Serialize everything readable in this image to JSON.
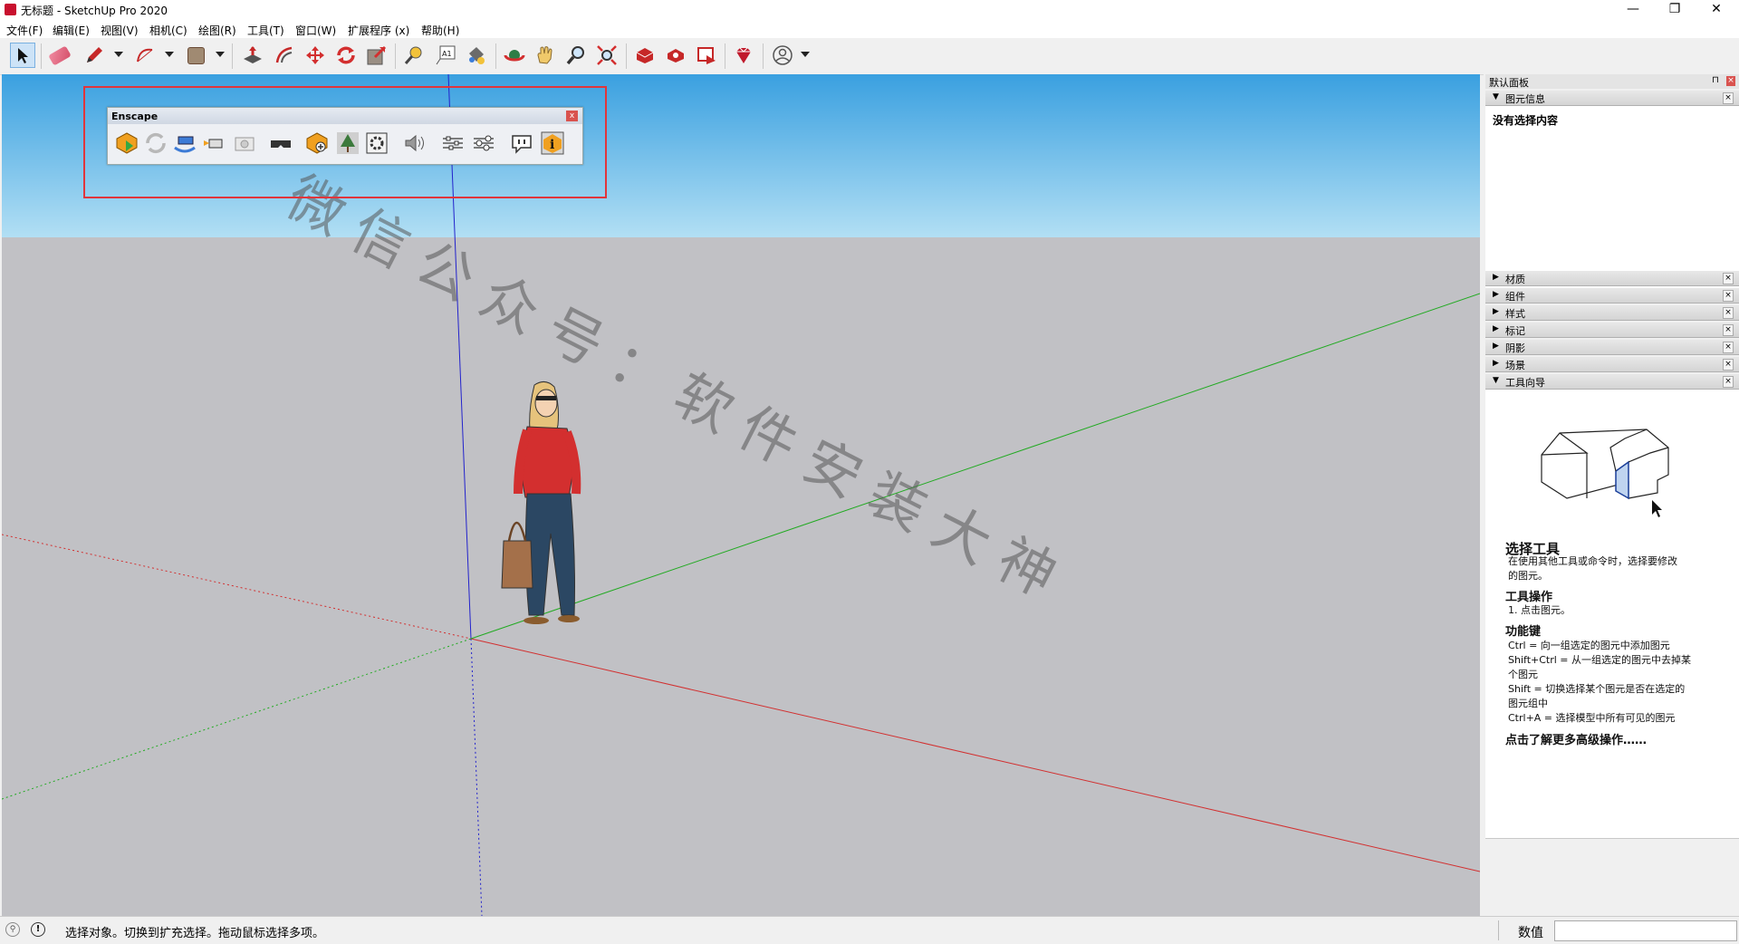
{
  "window": {
    "title": "无标题 - SketchUp Pro 2020",
    "minimize": "—",
    "restore": "❐",
    "close": "✕"
  },
  "menu": [
    "文件(F)",
    "编辑(E)",
    "视图(V)",
    "相机(C)",
    "绘图(R)",
    "工具(T)",
    "窗口(W)",
    "扩展程序 (x)",
    "帮助(H)"
  ],
  "toolbar": {
    "icons": [
      "select-icon",
      "eraser-icon",
      "pencil-icon",
      "arc-icon",
      "rectangle-icon",
      "push-pull-icon",
      "offset-icon",
      "move-icon",
      "rotate-icon",
      "scale-icon",
      "tape-measure-icon",
      "text-icon",
      "paint-bucket-icon",
      "orbit-icon",
      "pan-icon",
      "zoom-icon",
      "zoom-extents-icon",
      "warehouse-icon",
      "extension-warehouse-icon",
      "layout-icon",
      "ruby-icon",
      "account-icon"
    ]
  },
  "enscape": {
    "title": "Enscape",
    "close": "x"
  },
  "watermark": "微信公众号：软件安装大神",
  "right_panel": {
    "title": "默认面板",
    "entity_info": {
      "label": "图元信息",
      "content": "没有选择内容"
    },
    "panels": [
      "材质",
      "组件",
      "样式",
      "标记",
      "阴影",
      "场景",
      "工具向导"
    ],
    "guide": {
      "title": "选择工具",
      "desc_1": "在使用其他工具或命令时，选择要修改",
      "desc_2": "的图元。",
      "op_title": "工具操作",
      "op_1": "1. 点击图元。",
      "key_title": "功能键",
      "key_1": "Ctrl = 向一组选定的图元中添加图元",
      "key_2": "Shift+Ctrl = 从一组选定的图元中去掉某",
      "key_3": "个图元",
      "key_4": "Shift = 切换选择某个图元是否在选定的",
      "key_5": "图元组中",
      "key_6": "Ctrl+A = 选择模型中所有可见的图元",
      "more": "点击了解更多高级操作……"
    }
  },
  "status": {
    "text": "选择对象。切换到扩充选择。拖动鼠标选择多项。",
    "measure_label": "数值",
    "measure_value": ""
  },
  "colors": {
    "accent_red": "#e1353b",
    "axis_red": "#d23030",
    "axis_green": "#22aa22",
    "axis_blue": "#2222cc"
  }
}
